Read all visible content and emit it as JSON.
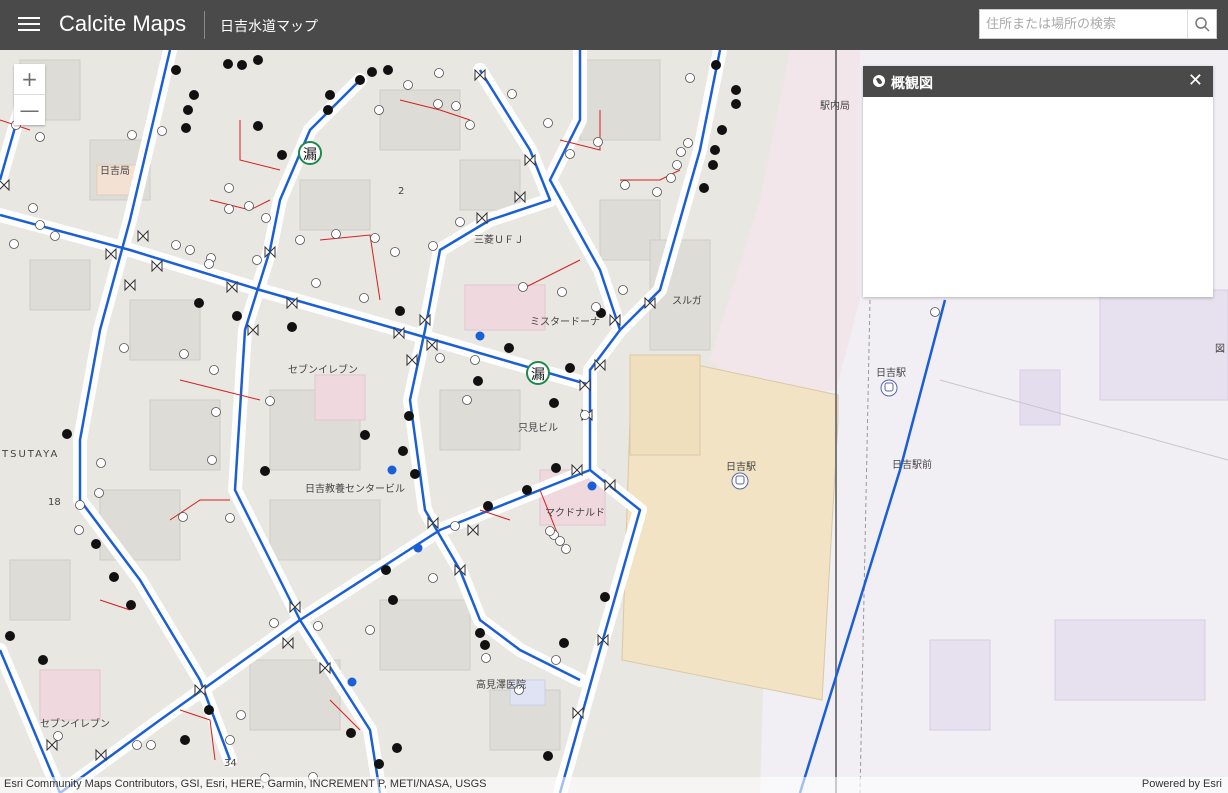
{
  "header": {
    "title": "Calcite Maps",
    "subtitle": "日吉水道マップ",
    "search_placeholder": "住所または場所の検索"
  },
  "zoom": {
    "in": "+",
    "out": "—"
  },
  "panel": {
    "title": "概観図",
    "close": "✕"
  },
  "map_labels": {
    "hiyoshi_post": "日吉局",
    "ekinai_post": "駅内局",
    "num2": "2",
    "mufg": "三菱ＵＦＪ",
    "suruga": "スルガ",
    "mister_donut": "ミスタードーナ",
    "seven_eleven_1": "セブンイレブン",
    "tsutaya": "TSUTAYA",
    "tadami": "只見ビル",
    "hiyoshi_station_1": "日吉駅",
    "hiyoshi_station_2": "日吉駅",
    "hiyoshi_ekimae": "日吉駅前",
    "kyoyo": "日吉教養センタービル",
    "mcdonalds": "マクドナルド",
    "num18": "18",
    "takamisawa": "高見澤医院",
    "seven_eleven_2": "セブンイレブン",
    "num34": "34",
    "leak_1": "漏",
    "leak_2": "漏",
    "zu": "図"
  },
  "attribution": {
    "left": "Esri Community Maps Contributors, GSI, Esri, HERE, Garmin, INCREMENT P, METI/NASA, USGS",
    "right": "Powered by Esri"
  },
  "colors": {
    "main_pipe": "#1a5fd6",
    "service_pipe": "#d81e1e",
    "header_bg": "#4a4a4a",
    "station_area": "#f1e3c4",
    "rail_area": "#f2e6ea"
  }
}
